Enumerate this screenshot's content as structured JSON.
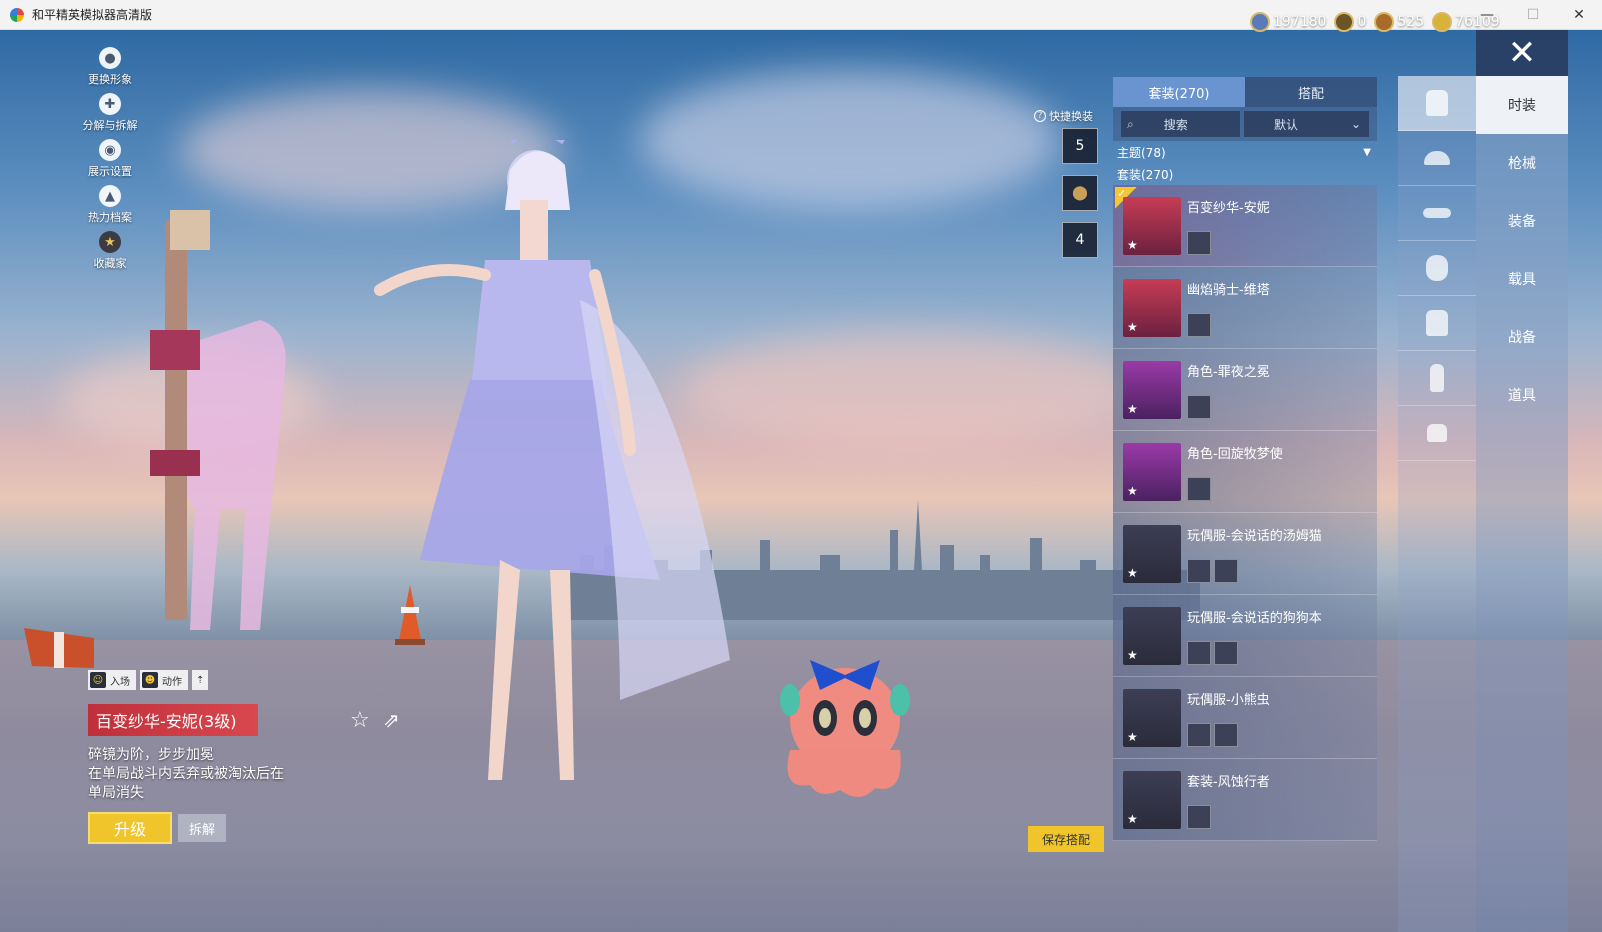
{
  "window": {
    "title": "和平精英模拟器高清版",
    "controls": [
      "—",
      "☐",
      "✕"
    ]
  },
  "currency": [
    {
      "icon": "coin-globe-icon",
      "value": "197180"
    },
    {
      "icon": "coin-token-icon",
      "value": "0"
    },
    {
      "icon": "coin-bronze-icon",
      "value": "525"
    },
    {
      "icon": "coin-gold-icon",
      "value": "76109"
    }
  ],
  "left_menu": [
    {
      "label": "更换形象",
      "icon": "avatar-icon"
    },
    {
      "label": "分解与拆解",
      "icon": "puzzle-icon"
    },
    {
      "label": "展示设置",
      "icon": "eye-icon"
    },
    {
      "label": "热力档案",
      "icon": "flame-icon"
    },
    {
      "label": "收藏家",
      "icon": "medal-icon"
    }
  ],
  "quick_change": {
    "label": "快捷换装",
    "slots": [
      "5",
      "",
      "4"
    ]
  },
  "panel": {
    "tabs": [
      "套装(270)",
      "搭配"
    ],
    "search_placeholder": "搜索",
    "sort_label": "默认",
    "filter_label": "主题(78)",
    "section_label": "套装(270)",
    "items": [
      {
        "name": "百变纱华-安妮",
        "subs": 1
      },
      {
        "name": "幽焰骑士-维塔",
        "subs": 1
      },
      {
        "name": "角色-罪夜之冕",
        "subs": 1
      },
      {
        "name": "角色-回旋牧梦使",
        "subs": 1
      },
      {
        "name": "玩偶服-会说话的汤姆猫",
        "subs": 2
      },
      {
        "name": "玩偶服-会说话的狗狗本",
        "subs": 2
      },
      {
        "name": "玩偶服-小熊虫",
        "subs": 2
      },
      {
        "name": "套装-风蚀行者",
        "subs": 1
      }
    ]
  },
  "category_nav": [
    "时装",
    "枪械",
    "装备",
    "载具",
    "战备",
    "道具"
  ],
  "anim_buttons": [
    {
      "label": "入场"
    },
    {
      "label": "动作"
    }
  ],
  "outfit": {
    "name": "百变纱华-安妮(3级)",
    "description": "碎镜为阶，步步加冕\n在单局战斗内丢弃或被淘汰后在单局消失",
    "upgrade_label": "升级",
    "dismantle_label": "拆解"
  },
  "save_label": "保存搭配",
  "colors": {
    "accent": "#f0c52b",
    "name_bar": "#c0303a",
    "tab_active": "#6a94cf"
  }
}
